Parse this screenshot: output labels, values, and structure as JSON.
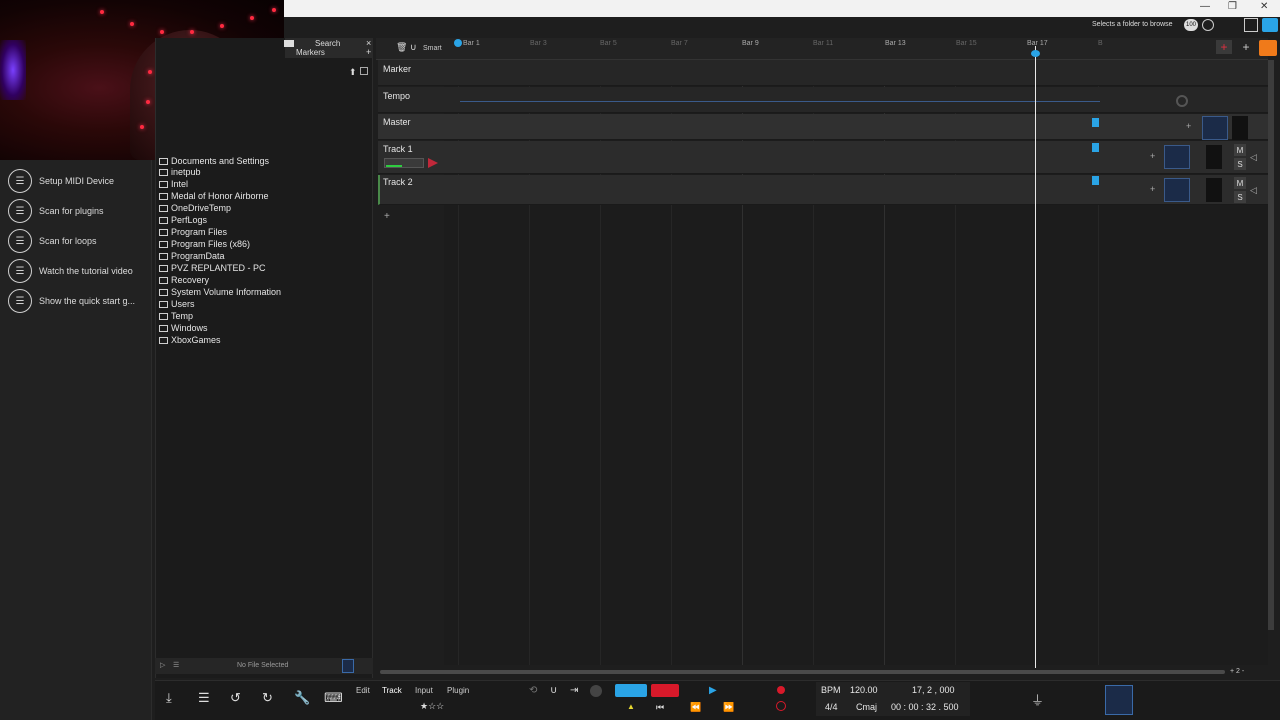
{
  "topbar": {
    "hint": "Selects a folder to browse",
    "zoom": "100",
    "plus": "+"
  },
  "browser": {
    "tabs": {
      "search": "Search",
      "markers": "Markers",
      "close": "×",
      "add": "+"
    },
    "folders": [
      "Documents and Settings",
      "inetpub",
      "Intel",
      "Medal of Honor Airborne",
      "OneDriveTemp",
      "PerfLogs",
      "Program Files",
      "Program Files (x86)",
      "ProgramData",
      "PVZ REPLANTED - PC",
      "Recovery",
      "System Volume Information",
      "Temp",
      "Users",
      "Windows",
      "XboxGames"
    ],
    "footer": "No File Selected"
  },
  "quickstart": [
    {
      "label": "Setup MIDI Device"
    },
    {
      "label": "Scan for plugins"
    },
    {
      "label": "Scan for loops"
    },
    {
      "label": "Watch the tutorial video"
    },
    {
      "label": "Show the quick start g..."
    }
  ],
  "timeline": {
    "smart": "Smart",
    "bars": [
      "Bar 1",
      "Bar 3",
      "Bar 5",
      "Bar 7",
      "Bar 9",
      "Bar 11",
      "Bar 13",
      "Bar 15",
      "Bar 17",
      "B"
    ]
  },
  "tracks": {
    "marker": "Marker",
    "tempo": "Tempo",
    "master": "Master",
    "track1": "Track 1",
    "track2": "Track 2",
    "mute": "M",
    "solo": "S",
    "add_track": "+"
  },
  "bottom": {
    "menu": [
      "Edit",
      "Track",
      "Input",
      "Plugin"
    ],
    "bpm_label": "BPM",
    "bpm": "120.00",
    "position": "17, 2 , 000",
    "timesig": "4/4",
    "key": "Cmaj",
    "time": "00 : 00 : 32 . 500",
    "zoom_label": "+ 2 -"
  },
  "colors": {
    "accent_blue": "#2aa4e6",
    "record_red": "#d8192a",
    "brand_orange": "#f07a1a"
  }
}
